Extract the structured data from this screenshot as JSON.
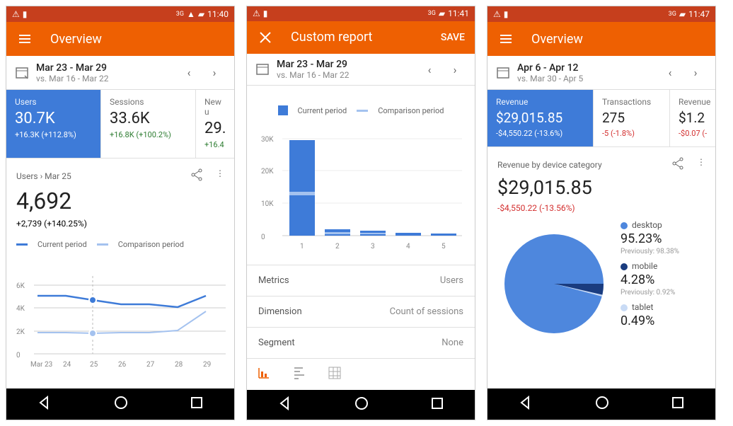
{
  "screens": [
    {
      "status_time": "11:40",
      "appbar": {
        "title": "Overview",
        "left_icon": "hamburger-icon"
      },
      "date": {
        "range": "Mar 23 - Mar 29",
        "compare": "vs. Mar 16 - Mar 22"
      },
      "tabs": [
        {
          "label": "Users",
          "value": "30.7K",
          "delta": "+16.3K (+112.8%)",
          "active": true
        },
        {
          "label": "Sessions",
          "value": "33.6K",
          "delta": "+16.8K (+100.2%)"
        },
        {
          "label": "New u",
          "value": "29.",
          "delta": "+16.4",
          "cut": true
        }
      ],
      "detail": {
        "path": "Users › Mar 25",
        "value": "4,692",
        "delta": "+2,739 (+140.25%)",
        "delta_color": "green"
      },
      "legend": {
        "a": "Current period",
        "b": "Comparison period"
      }
    },
    {
      "status_time": "11:41",
      "appbar": {
        "title": "Custom report",
        "left_icon": "close-icon",
        "action": "SAVE"
      },
      "date": {
        "range": "Mar 23 - Mar 29",
        "compare": "vs. Mar 16 - Mar 22"
      },
      "legend": {
        "a": "Current period",
        "b": "Comparison period"
      },
      "rows": [
        {
          "k": "Metrics",
          "v": "Users"
        },
        {
          "k": "Dimension",
          "v": "Count of sessions"
        },
        {
          "k": "Segment",
          "v": "None"
        }
      ]
    },
    {
      "status_time": "11:47",
      "appbar": {
        "title": "Overview",
        "left_icon": "hamburger-icon"
      },
      "date": {
        "range": "Apr 6 - Apr 12",
        "compare": "vs. Mar 30 - Apr 5"
      },
      "tabs": [
        {
          "label": "Revenue",
          "value": "$29,015.85",
          "delta": "-$4,550.22 (-13.6%)",
          "active": true
        },
        {
          "label": "Transactions",
          "value": "275",
          "delta": "-5 (-1.8%)",
          "delta_color": "red"
        },
        {
          "label": "Revenue",
          "value": "$1.2",
          "delta": "-$0.07 (-",
          "delta_color": "red",
          "cut": true
        }
      ],
      "detail": {
        "path": "Revenue by device category",
        "value": "$29,015.85",
        "delta": "-$4,550.22 (-13.56%)",
        "delta_color": "red"
      },
      "pie": [
        {
          "label": "desktop",
          "pct": "95.23%",
          "prev": "Previously: 98.38%",
          "color": "#4e87dd"
        },
        {
          "label": "mobile",
          "pct": "4.28%",
          "prev": "Previously: 0.92%",
          "color": "#1a3c7f"
        },
        {
          "label": "tablet",
          "pct": "0.49%",
          "color": "#c9dbf5"
        }
      ]
    }
  ],
  "chart_data": [
    {
      "type": "line",
      "categories": [
        "Mar 23",
        "24",
        "25",
        "26",
        "27",
        "28",
        "29"
      ],
      "series": [
        {
          "name": "Current period",
          "values": [
            5000,
            5000,
            4700,
            4400,
            4400,
            4200,
            5000
          ]
        },
        {
          "name": "Comparison period",
          "values": [
            2000,
            2000,
            1950,
            2000,
            2000,
            2200,
            3600
          ]
        }
      ],
      "ylim": [
        0,
        6000
      ],
      "ylabel": "",
      "highlight_x": "25"
    },
    {
      "type": "bar",
      "categories": [
        "1",
        "2",
        "3",
        "4",
        "5"
      ],
      "series": [
        {
          "name": "Current period",
          "values": [
            29000,
            2000,
            1500,
            800,
            500
          ]
        },
        {
          "name": "Comparison period",
          "values": [
            13000,
            1000,
            800,
            400,
            300
          ]
        }
      ],
      "ylim": [
        0,
        30000
      ],
      "ylabel": ""
    },
    {
      "type": "pie",
      "series": [
        {
          "name": "desktop",
          "value": 95.23
        },
        {
          "name": "mobile",
          "value": 4.28
        },
        {
          "name": "tablet",
          "value": 0.49
        }
      ]
    }
  ]
}
